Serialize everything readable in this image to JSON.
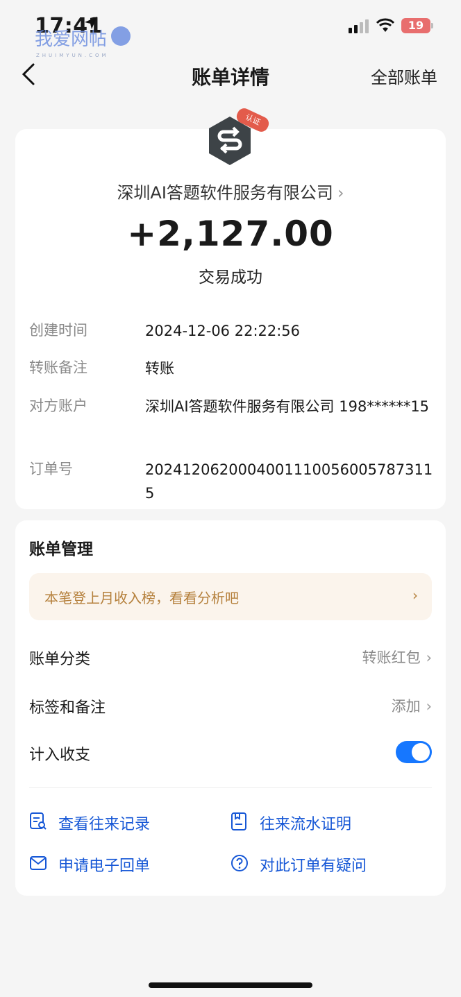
{
  "status_bar": {
    "time": "17:41",
    "battery": "19",
    "watermark": "我爱网帖",
    "watermark_sub": "ZHUIMYUN.COM"
  },
  "nav": {
    "back": "‹",
    "title": "账单详情",
    "right": "全部账单"
  },
  "transaction": {
    "merchant": "深圳AI答题软件服务有限公司",
    "merchant_chevron": "›",
    "logo_badge": "认证",
    "amount": "+2,127.00",
    "status": "交易成功",
    "details": [
      {
        "label": "创建时间",
        "value": "2024-12-06 22:22:56"
      },
      {
        "label": "转账备注",
        "value": "转账"
      },
      {
        "label": "对方账户",
        "value": "深圳AI答题软件服务有限公司 198******15"
      },
      {
        "label": "订单号",
        "value": "2024120620004001110056005787311 5"
      }
    ]
  },
  "management": {
    "title": "账单管理",
    "promo": "本笔登上月收入榜，看看分析吧",
    "promo_chevron": "›",
    "category_label": "账单分类",
    "category_value": "转账红包",
    "tag_label": "标签和备注",
    "tag_value": "添加",
    "include_label": "计入收支",
    "include_on": true,
    "chevron": "›",
    "actions": [
      {
        "label": "查看往来记录",
        "icon": "record-icon"
      },
      {
        "label": "往来流水证明",
        "icon": "certificate-icon"
      },
      {
        "label": "申请电子回单",
        "icon": "mail-icon"
      },
      {
        "label": "对此订单有疑问",
        "icon": "question-icon"
      }
    ]
  },
  "colors": {
    "accent": "#1677ff",
    "link": "#1657d6",
    "promo_bg": "#fbf4ec",
    "promo_text": "#b5803c",
    "background": "#f5f5f5"
  }
}
